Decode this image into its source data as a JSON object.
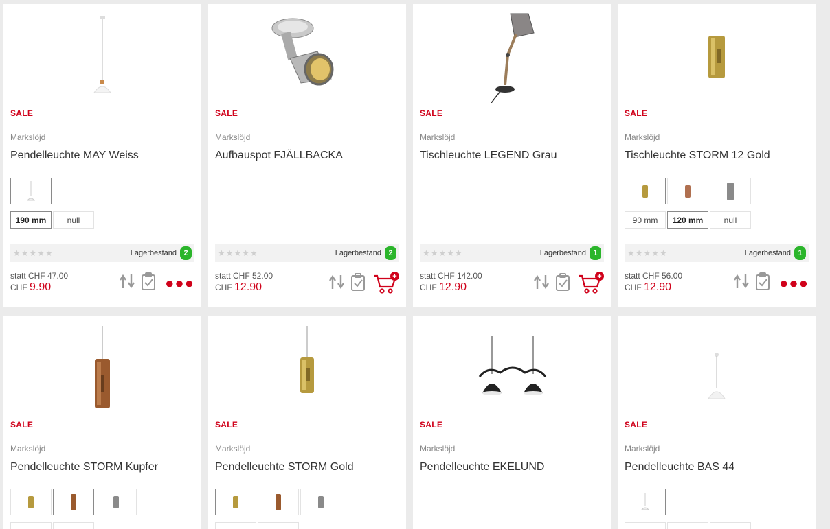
{
  "products": [
    {
      "sale": "SALE",
      "brand": "Markslöjd",
      "title": "Pendelleuchte MAY Weiss",
      "sizes": [
        {
          "label": "190 mm",
          "selected": true
        },
        {
          "label": "null",
          "selected": false
        }
      ],
      "rating_stars": "★★★★★",
      "stock_label": "Lagerbestand",
      "stock_count": "2",
      "old_price": "statt CHF 47.00",
      "currency": "CHF",
      "new_price": "9.90"
    },
    {
      "sale": "SALE",
      "brand": "Markslöjd",
      "title": "Aufbauspot FJÄLLBACKA",
      "rating_stars": "★★★★★",
      "stock_label": "Lagerbestand",
      "stock_count": "2",
      "old_price": "statt CHF 52.00",
      "currency": "CHF",
      "new_price": "12.90"
    },
    {
      "sale": "SALE",
      "brand": "Markslöjd",
      "title": "Tischleuchte LEGEND Grau",
      "rating_stars": "★★★★★",
      "stock_label": "Lagerbestand",
      "stock_count": "1",
      "old_price": "statt CHF 142.00",
      "currency": "CHF",
      "new_price": "12.90"
    },
    {
      "sale": "SALE",
      "brand": "Markslöjd",
      "title": "Tischleuchte STORM 12 Gold",
      "sizes": [
        {
          "label": "90 mm",
          "selected": false
        },
        {
          "label": "120 mm",
          "selected": true
        },
        {
          "label": "null",
          "selected": false
        }
      ],
      "rating_stars": "★★★★★",
      "stock_label": "Lagerbestand",
      "stock_count": "1",
      "old_price": "statt CHF 56.00",
      "currency": "CHF",
      "new_price": "12.90"
    },
    {
      "sale": "SALE",
      "brand": "Markslöjd",
      "title": "Pendelleuchte STORM Kupfer"
    },
    {
      "sale": "SALE",
      "brand": "Markslöjd",
      "title": "Pendelleuchte STORM Gold"
    },
    {
      "sale": "SALE",
      "brand": "Markslöjd",
      "title": "Pendelleuchte EKELUND"
    },
    {
      "sale": "SALE",
      "brand": "Markslöjd",
      "title": "Pendelleuchte BAS 44"
    }
  ],
  "cart_badge": "+",
  "icons": {
    "compare": "compare-icon",
    "notepad": "notepad-icon",
    "cart": "cart-icon",
    "more": "more-dots-icon"
  },
  "colors": {
    "sale_red": "#d0021b",
    "stock_green": "#2bb52b",
    "star_grey": "#cfcfcf"
  }
}
